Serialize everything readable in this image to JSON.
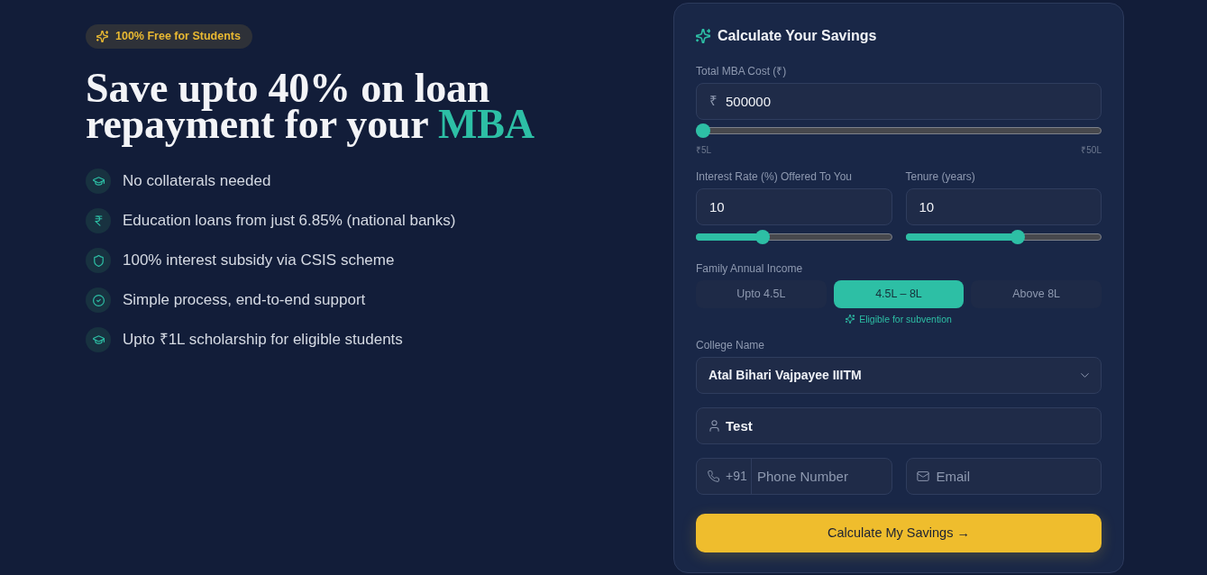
{
  "hero": {
    "badge": "100% Free for Students",
    "heading": "Save upto 40% on loan repayment for your",
    "heading_highlight": "MBA"
  },
  "features": [
    {
      "kind": "cap",
      "text": "No collaterals needed"
    },
    {
      "kind": "rupee",
      "text": "Education loans from just 6.85% (national banks)"
    },
    {
      "kind": "shield",
      "text": "100% interest subsidy via CSIS scheme"
    },
    {
      "kind": "check",
      "text": "Simple process, end-to-end support"
    },
    {
      "kind": "cap",
      "text": "Upto ₹1L scholarship for eligible students"
    }
  ],
  "calculator": {
    "title": "Calculate Your Savings",
    "cost": {
      "label": "Total MBA Cost (₹)",
      "prefix": "₹",
      "value": "500000",
      "level": 0,
      "min_label": "₹5L",
      "max_label": "₹50L"
    },
    "rate": {
      "label": "Interest Rate (%) Offered To You",
      "value": "10",
      "level": 0.33
    },
    "tenure": {
      "label": "Tenure (years)",
      "value": "10",
      "level": 0.58
    },
    "income": {
      "label": "Family Annual Income",
      "options": [
        {
          "label": "Upto 4.5L",
          "selected": false
        },
        {
          "label": "4.5L – 8L",
          "selected": true
        },
        {
          "label": "Above 8L",
          "selected": false
        }
      ],
      "note": "Eligible for subvention"
    },
    "college": {
      "label": "College Name",
      "value": "Atal Bihari Vajpayee IIITM"
    },
    "name_field": {
      "value": "Test"
    },
    "phone": {
      "code": "+91",
      "placeholder": "Phone Number"
    },
    "email": {
      "placeholder": "Email"
    },
    "submit": "Calculate My Savings →"
  }
}
